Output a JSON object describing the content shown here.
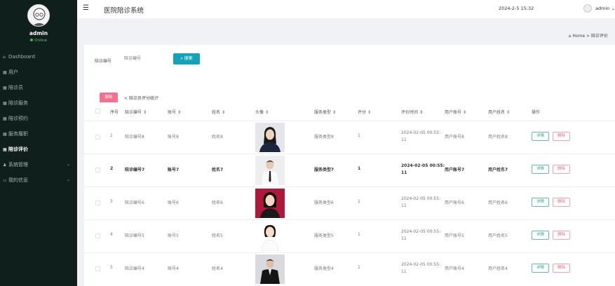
{
  "sidebar": {
    "user": "admin",
    "status": "Online",
    "items": [
      {
        "label": "Dashboard",
        "icon": "home-icon"
      },
      {
        "label": "用户",
        "icon": "grid-icon"
      },
      {
        "label": "陪诊员",
        "icon": "grid-icon"
      },
      {
        "label": "陪诊服务",
        "icon": "grid-icon"
      },
      {
        "label": "陪诊预约",
        "icon": "grid-icon"
      },
      {
        "label": "服务履职",
        "icon": "grid-icon"
      },
      {
        "label": "陪诊评价",
        "icon": "grid-icon"
      },
      {
        "label": "系统管理",
        "icon": "user-icon"
      },
      {
        "label": "我的信息",
        "icon": "card-icon"
      }
    ]
  },
  "header": {
    "title": "医院陪诊系统",
    "datetime": "2024-2-5 15:32",
    "user": "admin"
  },
  "breadcrumb": {
    "home": "Home",
    "separator": ">",
    "current": "陪诊评价"
  },
  "filter": {
    "label": "陪诊编号",
    "placeholder": "陪诊编号",
    "search_label": "搜索",
    "delete_label": "删除",
    "stats_link": "陪诊员评分统计"
  },
  "table": {
    "headers": [
      "序号",
      "陪诊编号",
      "账号",
      "姓名",
      "头像",
      "服务类型",
      "评分",
      "评价时间",
      "用户账号",
      "用户姓名",
      "操作"
    ],
    "detail_label": "详情",
    "delete_label": "删除",
    "rows": [
      {
        "index": "1",
        "code": "陪诊编号8",
        "account": "账号8",
        "name": "姓名8",
        "service": "服务类型8",
        "score": "1",
        "time1": "2024-02-05 00:55:",
        "time2": "11",
        "uacc": "用户账号8",
        "uname": "用户姓名8"
      },
      {
        "index": "2",
        "code": "陪诊编号7",
        "account": "账号7",
        "name": "姓名7",
        "service": "服务类型7",
        "score": "1",
        "time1": "2024-02-05 00:55:",
        "time2": "11",
        "uacc": "用户账号7",
        "uname": "用户姓名7"
      },
      {
        "index": "3",
        "code": "陪诊编号6",
        "account": "账号6",
        "name": "姓名6",
        "service": "服务类型6",
        "score": "1",
        "time1": "2024-02-05 00:55:",
        "time2": "11",
        "uacc": "用户账号6",
        "uname": "用户姓名6"
      },
      {
        "index": "4",
        "code": "陪诊编号5",
        "account": "账号5",
        "name": "姓名5",
        "service": "服务类型5",
        "score": "1",
        "time1": "2024-02-05 00:55:",
        "time2": "11",
        "uacc": "用户账号5",
        "uname": "用户姓名5"
      },
      {
        "index": "5",
        "code": "陪诊编号4",
        "account": "账号4",
        "name": "姓名4",
        "service": "服务类型4",
        "score": "1",
        "time1": "2024-02-05 00:55:",
        "time2": "11",
        "uacc": "用户账号4",
        "uname": "用户姓名4"
      }
    ]
  }
}
